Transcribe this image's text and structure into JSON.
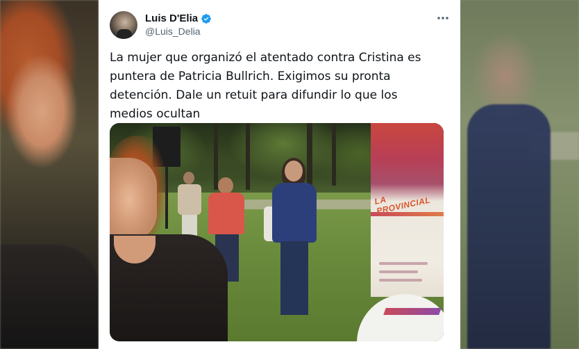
{
  "tweet": {
    "author": {
      "display_name": "Luis D'Elia",
      "handle": "@Luis_Delia",
      "verified": true
    },
    "text": "La mujer que organizó el atentado contra Cristina es\npuntera de Patricia Bullrich. Exigimos su pronta\ndetención. Dale un retuit para difundir lo que los\nmedios ocultan",
    "photo": {
      "banner_text": "LA PROVINCIAL"
    }
  },
  "icons": {
    "verified": "verified-badge-icon",
    "more": "more-options-icon"
  },
  "colors": {
    "verified_badge": "#1d9bf0",
    "name_text": "#0f1419",
    "handle_text": "#536471",
    "card_background": "#ffffff"
  }
}
